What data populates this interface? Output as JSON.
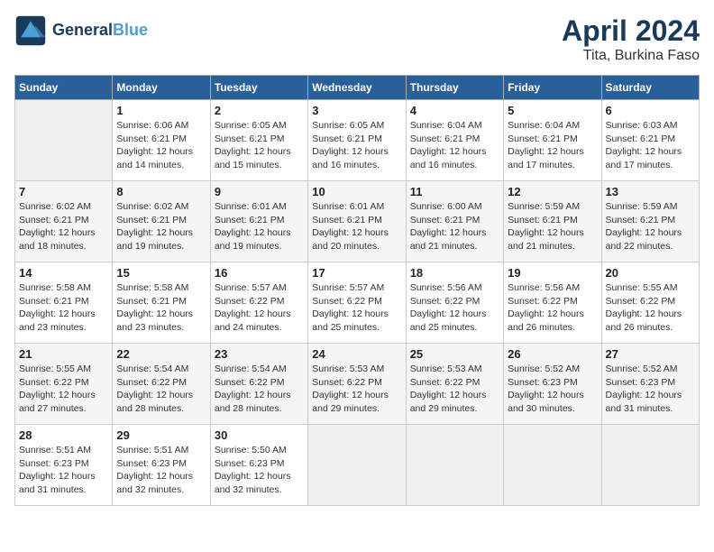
{
  "header": {
    "logo_line1": "General",
    "logo_line2": "Blue",
    "month": "April 2024",
    "location": "Tita, Burkina Faso"
  },
  "weekdays": [
    "Sunday",
    "Monday",
    "Tuesday",
    "Wednesday",
    "Thursday",
    "Friday",
    "Saturday"
  ],
  "weeks": [
    [
      {
        "day": "",
        "info": ""
      },
      {
        "day": "1",
        "info": "Sunrise: 6:06 AM\nSunset: 6:21 PM\nDaylight: 12 hours\nand 14 minutes."
      },
      {
        "day": "2",
        "info": "Sunrise: 6:05 AM\nSunset: 6:21 PM\nDaylight: 12 hours\nand 15 minutes."
      },
      {
        "day": "3",
        "info": "Sunrise: 6:05 AM\nSunset: 6:21 PM\nDaylight: 12 hours\nand 16 minutes."
      },
      {
        "day": "4",
        "info": "Sunrise: 6:04 AM\nSunset: 6:21 PM\nDaylight: 12 hours\nand 16 minutes."
      },
      {
        "day": "5",
        "info": "Sunrise: 6:04 AM\nSunset: 6:21 PM\nDaylight: 12 hours\nand 17 minutes."
      },
      {
        "day": "6",
        "info": "Sunrise: 6:03 AM\nSunset: 6:21 PM\nDaylight: 12 hours\nand 17 minutes."
      }
    ],
    [
      {
        "day": "7",
        "info": "Sunrise: 6:02 AM\nSunset: 6:21 PM\nDaylight: 12 hours\nand 18 minutes."
      },
      {
        "day": "8",
        "info": "Sunrise: 6:02 AM\nSunset: 6:21 PM\nDaylight: 12 hours\nand 19 minutes."
      },
      {
        "day": "9",
        "info": "Sunrise: 6:01 AM\nSunset: 6:21 PM\nDaylight: 12 hours\nand 19 minutes."
      },
      {
        "day": "10",
        "info": "Sunrise: 6:01 AM\nSunset: 6:21 PM\nDaylight: 12 hours\nand 20 minutes."
      },
      {
        "day": "11",
        "info": "Sunrise: 6:00 AM\nSunset: 6:21 PM\nDaylight: 12 hours\nand 21 minutes."
      },
      {
        "day": "12",
        "info": "Sunrise: 5:59 AM\nSunset: 6:21 PM\nDaylight: 12 hours\nand 21 minutes."
      },
      {
        "day": "13",
        "info": "Sunrise: 5:59 AM\nSunset: 6:21 PM\nDaylight: 12 hours\nand 22 minutes."
      }
    ],
    [
      {
        "day": "14",
        "info": "Sunrise: 5:58 AM\nSunset: 6:21 PM\nDaylight: 12 hours\nand 23 minutes."
      },
      {
        "day": "15",
        "info": "Sunrise: 5:58 AM\nSunset: 6:21 PM\nDaylight: 12 hours\nand 23 minutes."
      },
      {
        "day": "16",
        "info": "Sunrise: 5:57 AM\nSunset: 6:22 PM\nDaylight: 12 hours\nand 24 minutes."
      },
      {
        "day": "17",
        "info": "Sunrise: 5:57 AM\nSunset: 6:22 PM\nDaylight: 12 hours\nand 25 minutes."
      },
      {
        "day": "18",
        "info": "Sunrise: 5:56 AM\nSunset: 6:22 PM\nDaylight: 12 hours\nand 25 minutes."
      },
      {
        "day": "19",
        "info": "Sunrise: 5:56 AM\nSunset: 6:22 PM\nDaylight: 12 hours\nand 26 minutes."
      },
      {
        "day": "20",
        "info": "Sunrise: 5:55 AM\nSunset: 6:22 PM\nDaylight: 12 hours\nand 26 minutes."
      }
    ],
    [
      {
        "day": "21",
        "info": "Sunrise: 5:55 AM\nSunset: 6:22 PM\nDaylight: 12 hours\nand 27 minutes."
      },
      {
        "day": "22",
        "info": "Sunrise: 5:54 AM\nSunset: 6:22 PM\nDaylight: 12 hours\nand 28 minutes."
      },
      {
        "day": "23",
        "info": "Sunrise: 5:54 AM\nSunset: 6:22 PM\nDaylight: 12 hours\nand 28 minutes."
      },
      {
        "day": "24",
        "info": "Sunrise: 5:53 AM\nSunset: 6:22 PM\nDaylight: 12 hours\nand 29 minutes."
      },
      {
        "day": "25",
        "info": "Sunrise: 5:53 AM\nSunset: 6:22 PM\nDaylight: 12 hours\nand 29 minutes."
      },
      {
        "day": "26",
        "info": "Sunrise: 5:52 AM\nSunset: 6:23 PM\nDaylight: 12 hours\nand 30 minutes."
      },
      {
        "day": "27",
        "info": "Sunrise: 5:52 AM\nSunset: 6:23 PM\nDaylight: 12 hours\nand 31 minutes."
      }
    ],
    [
      {
        "day": "28",
        "info": "Sunrise: 5:51 AM\nSunset: 6:23 PM\nDaylight: 12 hours\nand 31 minutes."
      },
      {
        "day": "29",
        "info": "Sunrise: 5:51 AM\nSunset: 6:23 PM\nDaylight: 12 hours\nand 32 minutes."
      },
      {
        "day": "30",
        "info": "Sunrise: 5:50 AM\nSunset: 6:23 PM\nDaylight: 12 hours\nand 32 minutes."
      },
      {
        "day": "",
        "info": ""
      },
      {
        "day": "",
        "info": ""
      },
      {
        "day": "",
        "info": ""
      },
      {
        "day": "",
        "info": ""
      }
    ]
  ]
}
